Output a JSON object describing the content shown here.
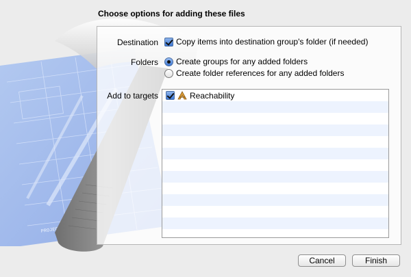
{
  "dialog": {
    "heading": "Choose options for adding these files"
  },
  "destination": {
    "label": "Destination",
    "option": "Copy items into destination group's folder (if needed)",
    "checked": true
  },
  "folders": {
    "label": "Folders",
    "options": [
      {
        "label": "Create groups for any added folders",
        "selected": true
      },
      {
        "label": "Create folder references for any added folders",
        "selected": false
      }
    ]
  },
  "targets": {
    "label": "Add to targets",
    "items": [
      {
        "name": "Reachability",
        "checked": true,
        "icon": "app-target-icon"
      }
    ]
  },
  "buttons": {
    "cancel": "Cancel",
    "finish": "Finish"
  },
  "background": {
    "blueprint_text": "PROJECT: APPLICATION_APP",
    "icon": "xcode-hammer-icon"
  },
  "colors": {
    "window_bg": "#ececec",
    "blueprint": "#8fb0ec",
    "accent": "#3d77d4"
  }
}
